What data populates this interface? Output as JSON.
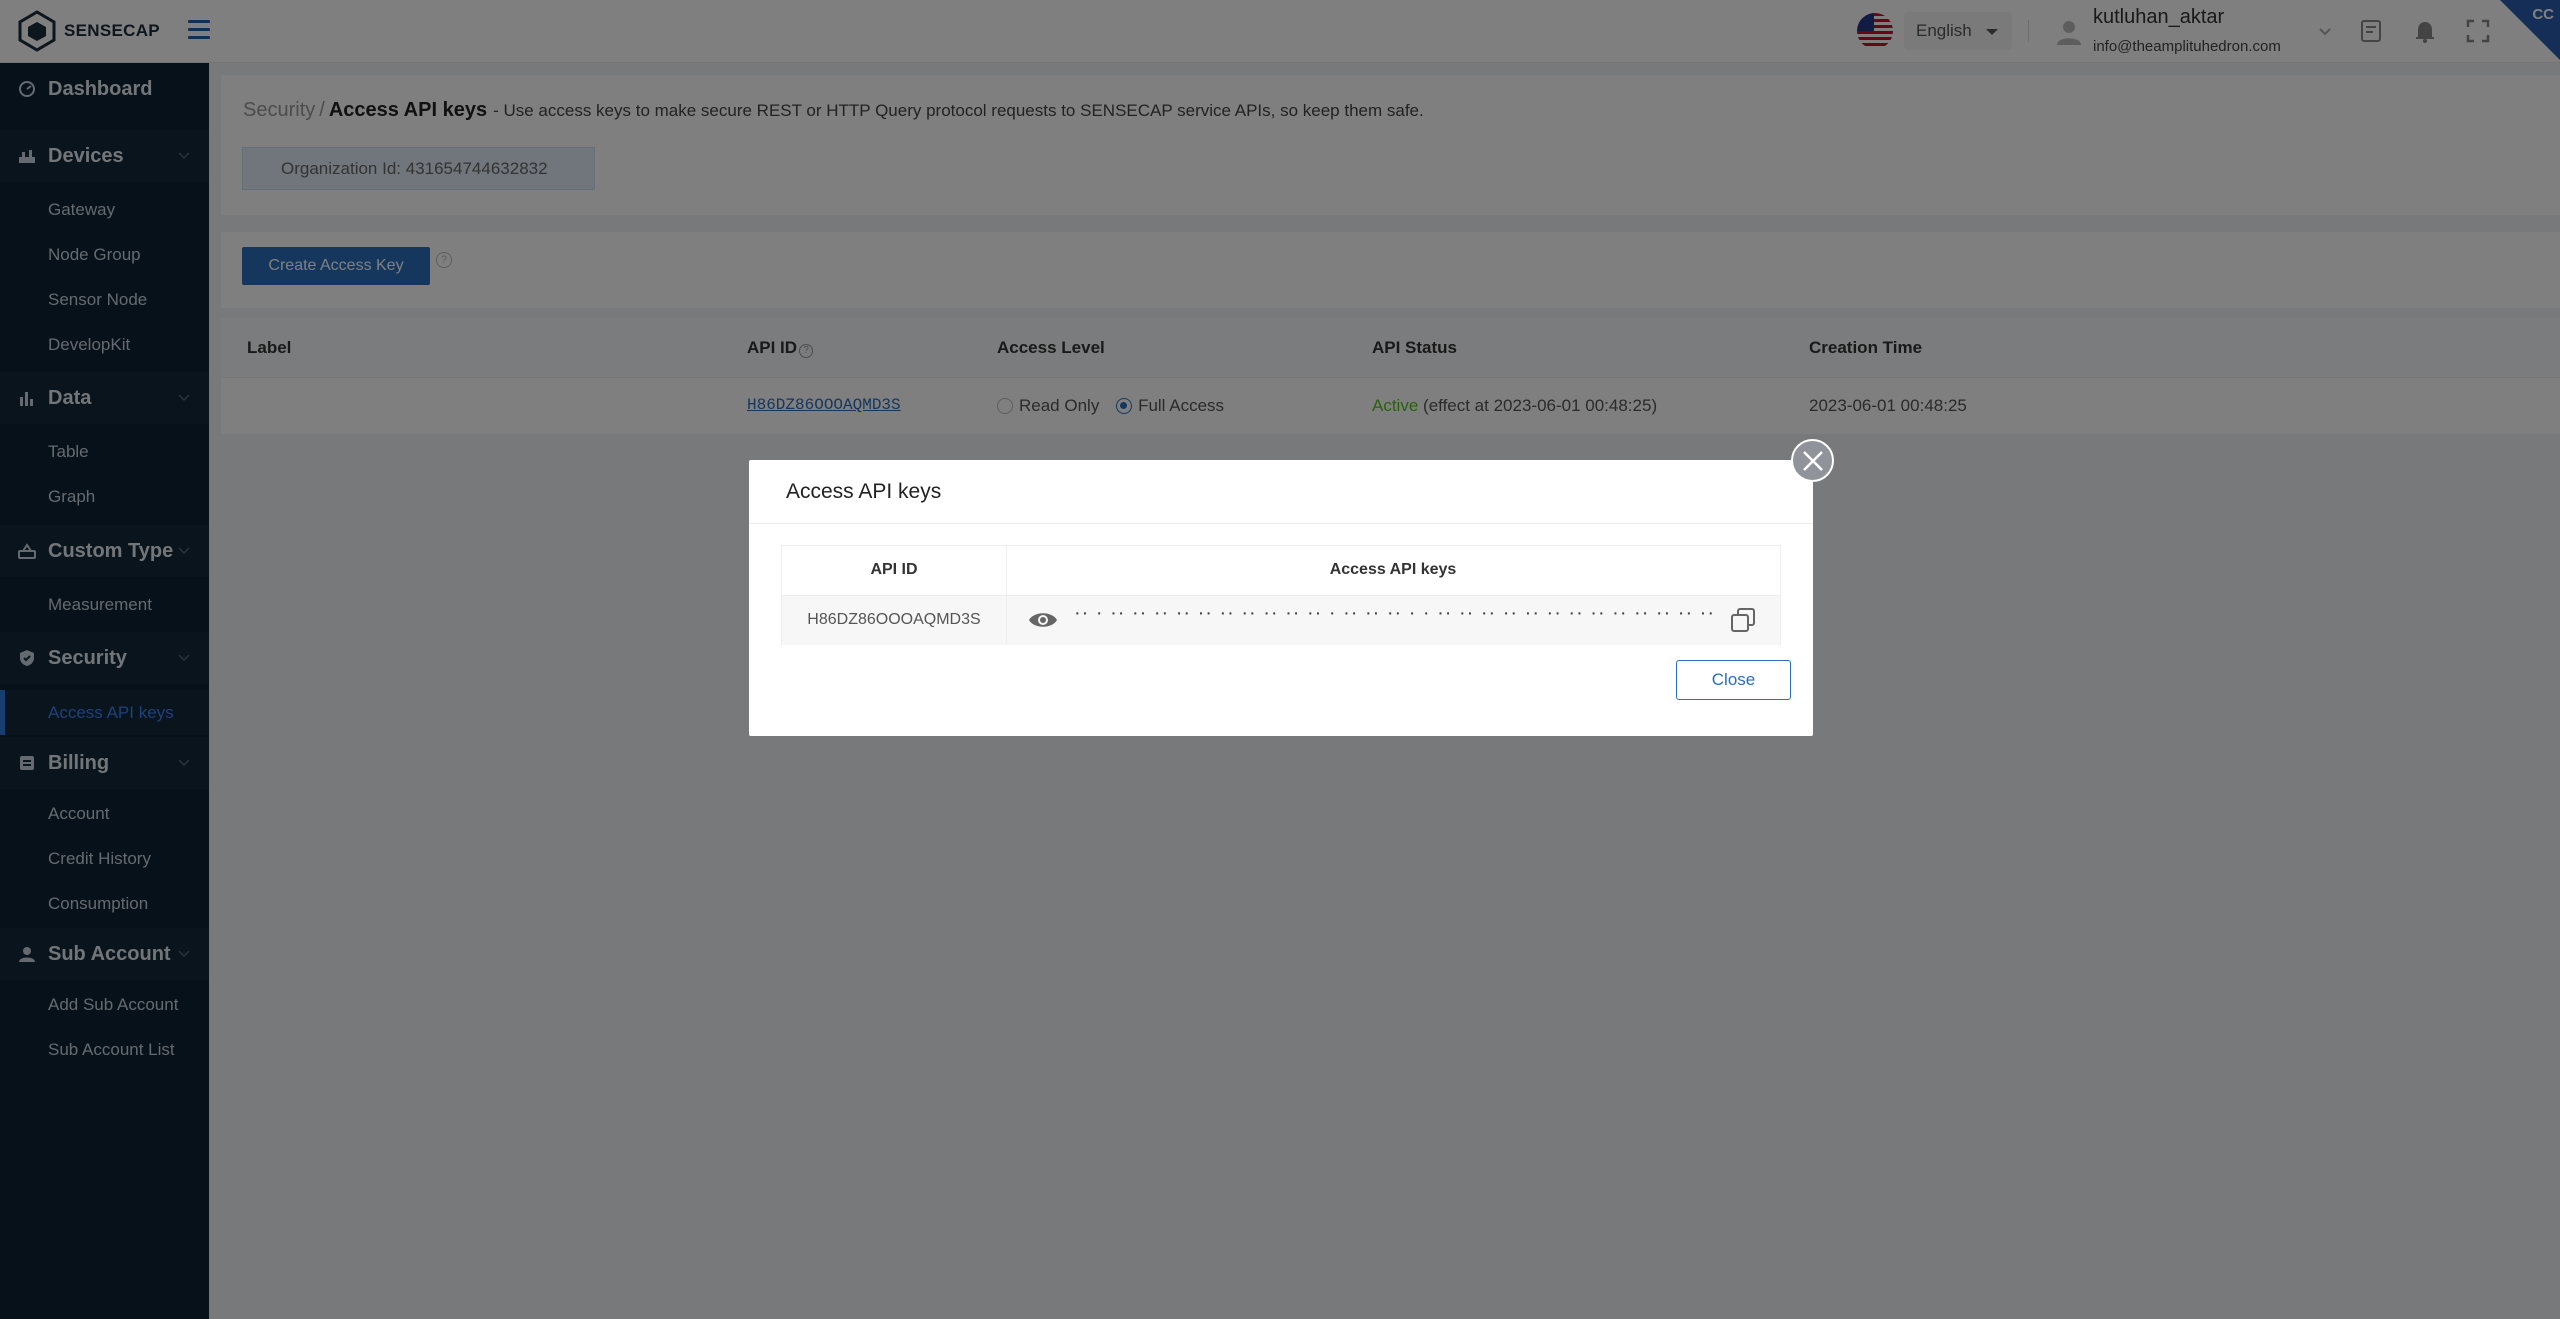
{
  "app": {
    "logo_text": "SENSECAP",
    "corner_badge": "CC"
  },
  "header": {
    "language": "English",
    "username": "kutluhan_aktar",
    "email": "info@theamplituhedron.com"
  },
  "sidebar": {
    "sections": [
      {
        "label": "Dashboard",
        "icon": "dashboard-icon"
      },
      {
        "label": "Devices",
        "icon": "devices-icon",
        "items": [
          "Gateway",
          "Node Group",
          "Sensor Node",
          "DevelopKit"
        ]
      },
      {
        "label": "Data",
        "icon": "data-chart-icon",
        "items": [
          "Table",
          "Graph"
        ]
      },
      {
        "label": "Custom Type",
        "icon": "custom-type-icon",
        "items": [
          "Measurement"
        ]
      },
      {
        "label": "Security",
        "icon": "shield-icon",
        "items": [
          "Access API keys"
        ]
      },
      {
        "label": "Billing",
        "icon": "billing-icon",
        "items": [
          "Account",
          "Credit History",
          "Consumption"
        ]
      },
      {
        "label": "Sub Account",
        "icon": "user-icon",
        "items": [
          "Add Sub Account",
          "Sub Account List"
        ]
      }
    ]
  },
  "main": {
    "breadcrumb_parent": "Security",
    "breadcrumb_sep": "/",
    "breadcrumb_current": "Access API keys",
    "breadcrumb_desc": "- Use access keys to make secure REST or HTTP Query protocol requests to SENSECAP service APIs, so keep them safe.",
    "org_id": "Organization Id: 431654744632832",
    "create_button": "Create Access Key",
    "table": {
      "headers": [
        "Label",
        "API ID",
        "Access Level",
        "API Status",
        "Creation Time"
      ],
      "row": {
        "label": "",
        "api_id": "H86DZ86OOOAQMD3S",
        "access_read": "Read Only",
        "access_full": "Full Access",
        "status": "Active",
        "status_detail": "(effect at 2023-06-01 00:48:25)",
        "creation_time": "2023-06-01 00:48:25"
      }
    }
  },
  "modal": {
    "title": "Access API keys",
    "col_api_id": "API ID",
    "col_keys": "Access API keys",
    "api_id": "H86DZ86OOOAQMD3S",
    "masked_key": "·· · ·· ·· ·· ·· ·· ·· ·· ·· ··  ·· ·  ·· ··  ·· · ·  ·· ·· ·· ·· ·· ·· ·· ·· ·· ·· ·· ·· ·· ··  ·· ·· ·· ·· ·· ·",
    "close_button": "Close"
  }
}
